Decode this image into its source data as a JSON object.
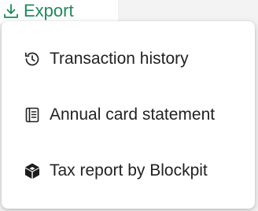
{
  "export": {
    "label": "Export",
    "icon": "download-icon",
    "color": "#1e8a5a"
  },
  "menu": {
    "items": [
      {
        "label": "Transaction history",
        "icon": "history-icon"
      },
      {
        "label": "Annual card statement",
        "icon": "document-icon"
      },
      {
        "label": "Tax report by Blockpit",
        "icon": "blockpit-logo-icon"
      }
    ]
  },
  "colors": {
    "accent": "#1e8a5a",
    "text": "#222222",
    "menu_background": "#ffffff"
  }
}
